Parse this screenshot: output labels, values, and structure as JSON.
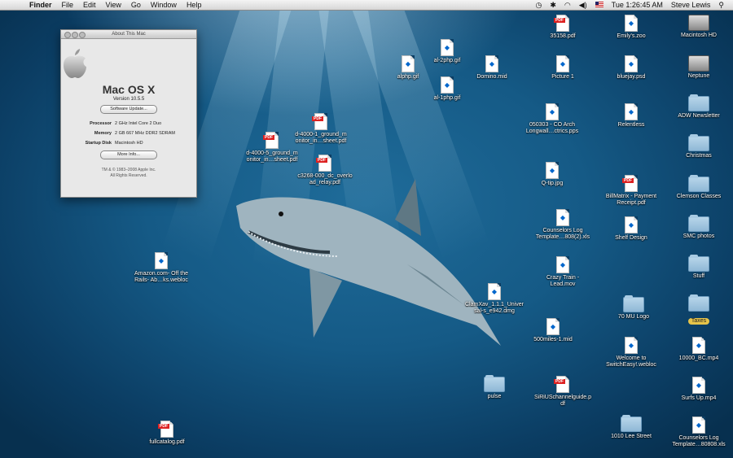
{
  "menubar": {
    "apple_icon": "apple-icon",
    "items": [
      "Finder",
      "File",
      "Edit",
      "View",
      "Go",
      "Window",
      "Help"
    ],
    "time": "Tue 1:26:45 AM",
    "user": "Steve Lewis"
  },
  "about_window": {
    "title": "About This Mac",
    "os_name": "Mac OS X",
    "version": "Version 10.5.5",
    "software_update_button": "Software Update...",
    "processor_label": "Processor",
    "processor_value": "2 GHz Intel Core 2 Duo",
    "memory_label": "Memory",
    "memory_value": "2 GB 667 MHz DDR2 SDRAM",
    "startup_label": "Startup Disk",
    "startup_value": "Macintosh HD",
    "more_info_button": "More Info...",
    "copyright_1": "TM & © 1983–2008 Apple Inc.",
    "copyright_2": "All Rights Reserved."
  },
  "icons": [
    {
      "label": "Macintosh HD",
      "kind": "disk"
    },
    {
      "label": "Neptune",
      "kind": "disk"
    },
    {
      "label": "ADW Newsletter",
      "kind": "folder"
    },
    {
      "label": "Christmas",
      "kind": "folder"
    },
    {
      "label": "Clemson Classes",
      "kind": "folder"
    },
    {
      "label": "SMC photos",
      "kind": "folder"
    },
    {
      "label": "Stuff",
      "kind": "folder"
    },
    {
      "label": "Taxes",
      "kind": "folder"
    },
    {
      "label": "10000_BC.mp4",
      "kind": "generic"
    },
    {
      "label": "Surfs Up.mp4",
      "kind": "generic"
    },
    {
      "label": "Counselors Log\nTemplate…80808.xls",
      "kind": "generic"
    },
    {
      "label": "Emily's.zoo",
      "kind": "generic"
    },
    {
      "label": "bluejay.psd",
      "kind": "generic"
    },
    {
      "label": "Relentless",
      "kind": "generic"
    },
    {
      "label": "BillMatrix - Payment\nReceipt.pdf",
      "kind": "pdf"
    },
    {
      "label": "Shelf Design",
      "kind": "generic"
    },
    {
      "label": "70 MU Logo",
      "kind": "folder"
    },
    {
      "label": "Welcome to\nSwitchEasy!.webloc",
      "kind": "generic"
    },
    {
      "label": "1010 Lee Street",
      "kind": "folder"
    },
    {
      "label": "35158.pdf",
      "kind": "pdf"
    },
    {
      "label": "Picture 1",
      "kind": "generic"
    },
    {
      "label": "050303 - CO Arch\nLongwall…ctrics.pps",
      "kind": "generic"
    },
    {
      "label": "Q-tip.jpg",
      "kind": "generic"
    },
    {
      "label": "Counselors Log\nTemplate…808(2).xls",
      "kind": "generic"
    },
    {
      "label": "Crazy Train -\nLead.mov",
      "kind": "generic"
    },
    {
      "label": "500miles-1.mid",
      "kind": "generic"
    },
    {
      "label": "SiRiUSchannelguide.p\ndf",
      "kind": "pdf"
    },
    {
      "label": "pulse",
      "kind": "folder"
    },
    {
      "label": "ClamXav_1.1.1_Univer\nsal-s_e942.dmg",
      "kind": "generic"
    },
    {
      "label": "al-2php.gif",
      "kind": "generic"
    },
    {
      "label": "alphp.gif",
      "kind": "generic"
    },
    {
      "label": "Domino.mid",
      "kind": "generic"
    },
    {
      "label": "al-1php.gif",
      "kind": "generic"
    },
    {
      "label": "d-4000-1_ground_m\nonitor_in…sheet.pdf",
      "kind": "pdf"
    },
    {
      "label": "d-4000-5_ground_m\nonitor_in…sheet.pdf",
      "kind": "pdf"
    },
    {
      "label": "c3268-000_dc_overlo\nad_relay.pdf",
      "kind": "pdf"
    },
    {
      "label": "Amazon.com- Off the\nRails- Ab…ks.webloc",
      "kind": "generic"
    },
    {
      "label": "fullcatalog.pdf",
      "kind": "pdf"
    }
  ]
}
